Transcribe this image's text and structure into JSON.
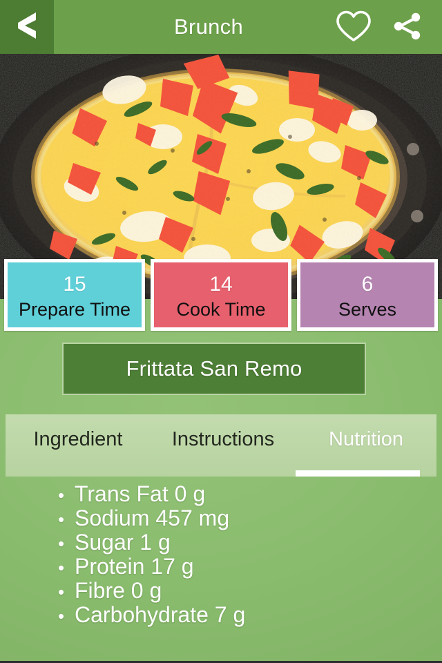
{
  "header": {
    "title": "Brunch",
    "back_icon": "chevron-left-icon",
    "favorite_icon": "heart-outline-icon",
    "share_icon": "share-icon"
  },
  "hero": {
    "alt": "frittata-in-pan-photo"
  },
  "stats": [
    {
      "key": "prepare_time",
      "value": "15",
      "label": "Prepare Time",
      "color": "#3cc4d0"
    },
    {
      "key": "cook_time",
      "value": "14",
      "label": "Cook Time",
      "color": "#e34655"
    },
    {
      "key": "serves",
      "value": "6",
      "label": "Serves",
      "color": "#a3659d"
    }
  ],
  "recipe": {
    "title": "Frittata San Remo"
  },
  "tabs": [
    {
      "key": "ingredient",
      "label": "Ingredient",
      "active": false
    },
    {
      "key": "instructions",
      "label": "Instructions",
      "active": false
    },
    {
      "key": "nutrition",
      "label": "Nutrition",
      "active": true
    }
  ],
  "nutrition": {
    "items": [
      "Trans Fat 0 g",
      "Sodium 457 mg",
      "Sugar 1 g",
      "Protein 17 g",
      "Fibre 0 g",
      "Carbohydrate 7 g"
    ],
    "bullet": "•"
  },
  "colors": {
    "header_green": "#6da04a",
    "back_green": "#4d7c33",
    "page_green": "#8abc6e",
    "title_box_green": "#4e7f36",
    "tabbar_green": "#bfd9a8",
    "white": "#ffffff"
  }
}
